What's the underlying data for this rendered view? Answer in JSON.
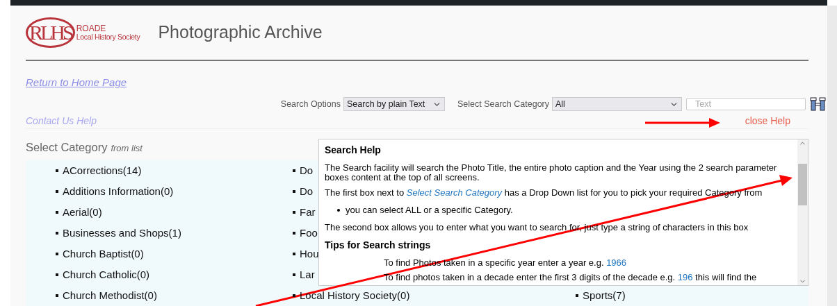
{
  "logo": {
    "monogram": "RLHS",
    "name": "ROADE",
    "subtitle": "Local History Society"
  },
  "title": "Photographic Archive",
  "home_link": "Return to Home Page",
  "search": {
    "options_label": "Search Options",
    "options_value": "Search by plain Text",
    "category_label": "Select Search Category",
    "category_value": "All",
    "text_placeholder": "Text"
  },
  "contact_link": "Contact Us Help",
  "close_help": "close Help",
  "category_heading": {
    "text": "Select Category",
    "hint": "from list"
  },
  "rows": [
    {
      "column_1": "ACorrections(14)",
      "column_2": "Do"
    },
    {
      "column_1": "Additions Information(0)",
      "column_2": "Do"
    },
    {
      "column_1": "Aerial(0)",
      "column_2": "Far"
    },
    {
      "column_1": "Businesses and Shops(1)",
      "column_2": "Foo"
    },
    {
      "column_1": "Church Baptist(0)",
      "column_2": "Hou"
    },
    {
      "column_1": "Church Catholic(0)",
      "column_2": "Lar"
    },
    {
      "column_1": "Church Methodist(0)",
      "column_2": "Local History Society(0)",
      "column_3": "Sports(7)"
    }
  ],
  "help": {
    "title": "Search Help",
    "blocks": [
      {
        "kind": "para",
        "text": "The Search facility will search the Photo Title, the entire photo caption and the Year using the 2 search parameter boxes content at the top of all screens."
      },
      {
        "kind": "para_link",
        "before": "The first box next to",
        "link": "Select Search Category",
        "after": "has a Drop Down list for you to pick your required Category from"
      },
      {
        "kind": "bullet",
        "text": "you can select ALL or a specific Category."
      },
      {
        "kind": "para",
        "text": "The second box allows you to enter what you want to search for, just type a string of characters in this box"
      },
      {
        "kind": "heading",
        "text": "Tips for Search strings"
      },
      {
        "kind": "tip",
        "before": "To find Photos taken in a specific year enter a year e.g.",
        "link": "1966"
      },
      {
        "kind": "tip",
        "before": "To find photos taken in a decade enter the first 3 digits of the decade e.g.",
        "link": "196",
        "after": "this will find the"
      }
    ]
  }
}
